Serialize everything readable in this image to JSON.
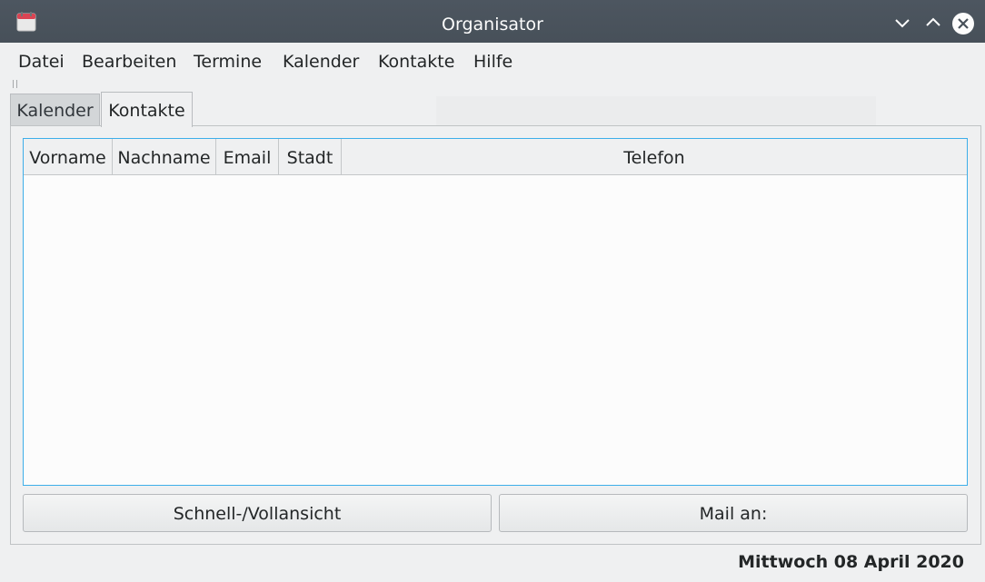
{
  "window": {
    "title": "Organisator"
  },
  "menu": [
    "Datei",
    "Bearbeiten",
    "Termine",
    "Kalender",
    "Kontakte",
    "Hilfe"
  ],
  "tabs": [
    "Kalender",
    "Kontakte"
  ],
  "active_tab": "Kontakte",
  "table": {
    "columns": [
      "Vorname",
      "Nachname",
      "Email",
      "Stadt",
      "Telefon"
    ],
    "rows": []
  },
  "buttons": {
    "quick_view": "Schnell-/Vollansicht",
    "mail_to": "Mail an:"
  },
  "status": {
    "date": "Mittwoch 08 April 2020"
  },
  "colors": {
    "titlebar": "#475059",
    "selection_border": "#3daee9"
  }
}
